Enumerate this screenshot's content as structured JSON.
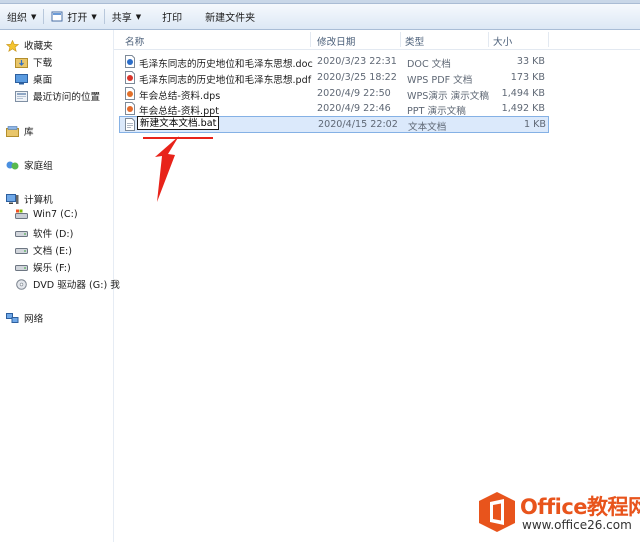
{
  "toolbar": {
    "organize": "组织",
    "open": "打开",
    "share": "共享",
    "print": "打印",
    "new_folder": "新建文件夹"
  },
  "nav": {
    "favorites": "收藏夹",
    "downloads": "下载",
    "desktop": "桌面",
    "recent": "最近访问的位置",
    "libraries": "库",
    "homegroup": "家庭组",
    "computer": "计算机",
    "drives": [
      {
        "label": "Win7 (C:)"
      },
      {
        "label": "软件 (D:)"
      },
      {
        "label": "文档 (E:)"
      },
      {
        "label": "娱乐 (F:)"
      },
      {
        "label": "DVD 驱动器 (G:) 我"
      }
    ],
    "network": "网络"
  },
  "columns": {
    "name": "名称",
    "modified": "修改日期",
    "type": "类型",
    "size": "大小"
  },
  "files": [
    {
      "name": "毛泽东同志的历史地位和毛泽东思想.doc",
      "modified": "2020/3/23 22:31",
      "type": "DOC 文档",
      "size": "33 KB",
      "icon": "doc-icon"
    },
    {
      "name": "毛泽东同志的历史地位和毛泽东思想.pdf",
      "modified": "2020/3/25 18:22",
      "type": "WPS PDF 文档",
      "size": "173 KB",
      "icon": "pdf-icon"
    },
    {
      "name": "年会总结-资料.dps",
      "modified": "2020/4/9 22:50",
      "type": "WPS演示 演示文稿",
      "size": "1,494 KB",
      "icon": "dps-icon"
    },
    {
      "name": "年会总结-资料.ppt",
      "modified": "2020/4/9 22:46",
      "type": "PPT 演示文稿",
      "size": "1,492 KB",
      "icon": "ppt-icon"
    },
    {
      "name": "",
      "modified": "2020/4/15 22:02",
      "type": "文本文档",
      "size": "1 KB",
      "icon": "txt-icon"
    }
  ],
  "rename_value": "新建文本文档.bat",
  "watermark": {
    "title": "Office教程网",
    "url": "www.office26.com"
  },
  "colors": {
    "annotation": "#e8231a",
    "selection": "#dbe9fb",
    "brand": "#e8541c"
  }
}
